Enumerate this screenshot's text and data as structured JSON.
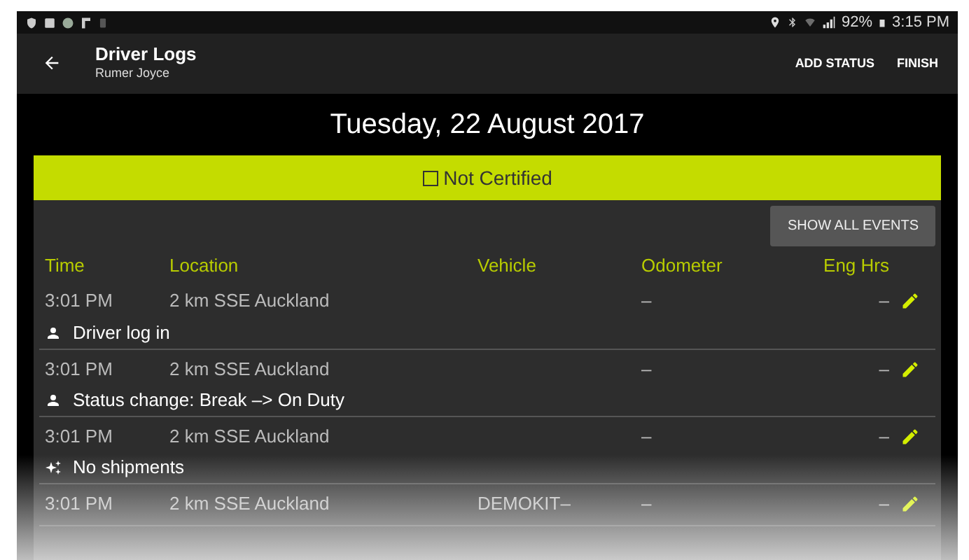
{
  "status_bar": {
    "battery": "92%",
    "time": "3:15 PM"
  },
  "toolbar": {
    "title": "Driver Logs",
    "subtitle": "Rumer Joyce",
    "actions": [
      "ADD STATUS",
      "FINISH"
    ]
  },
  "date": "Tuesday, 22 August 2017",
  "certification": {
    "label": "Not Certified",
    "checked": false
  },
  "show_all_button": "SHOW ALL EVENTS",
  "table": {
    "columns": [
      "Time",
      "Location",
      "Vehicle",
      "Odometer",
      "Eng Hrs"
    ],
    "rows": [
      {
        "time": "3:01 PM",
        "location": "2 km SSE Auckland",
        "vehicle": "",
        "odometer": "–",
        "eng_hrs": "–",
        "kind": "driver",
        "note": "Driver log in"
      },
      {
        "time": "3:01 PM",
        "location": "2 km SSE Auckland",
        "vehicle": "",
        "odometer": "–",
        "eng_hrs": "–",
        "kind": "driver",
        "note": "Status change: Break –> On Duty"
      },
      {
        "time": "3:01 PM",
        "location": "2 km SSE Auckland",
        "vehicle": "",
        "odometer": "–",
        "eng_hrs": "–",
        "kind": "shipment",
        "note": "No shipments"
      },
      {
        "time": "3:01 PM",
        "location": "2 km SSE Auckland",
        "vehicle": "DEMOKIT–",
        "odometer": "–",
        "eng_hrs": "–",
        "kind": "plain"
      }
    ]
  }
}
